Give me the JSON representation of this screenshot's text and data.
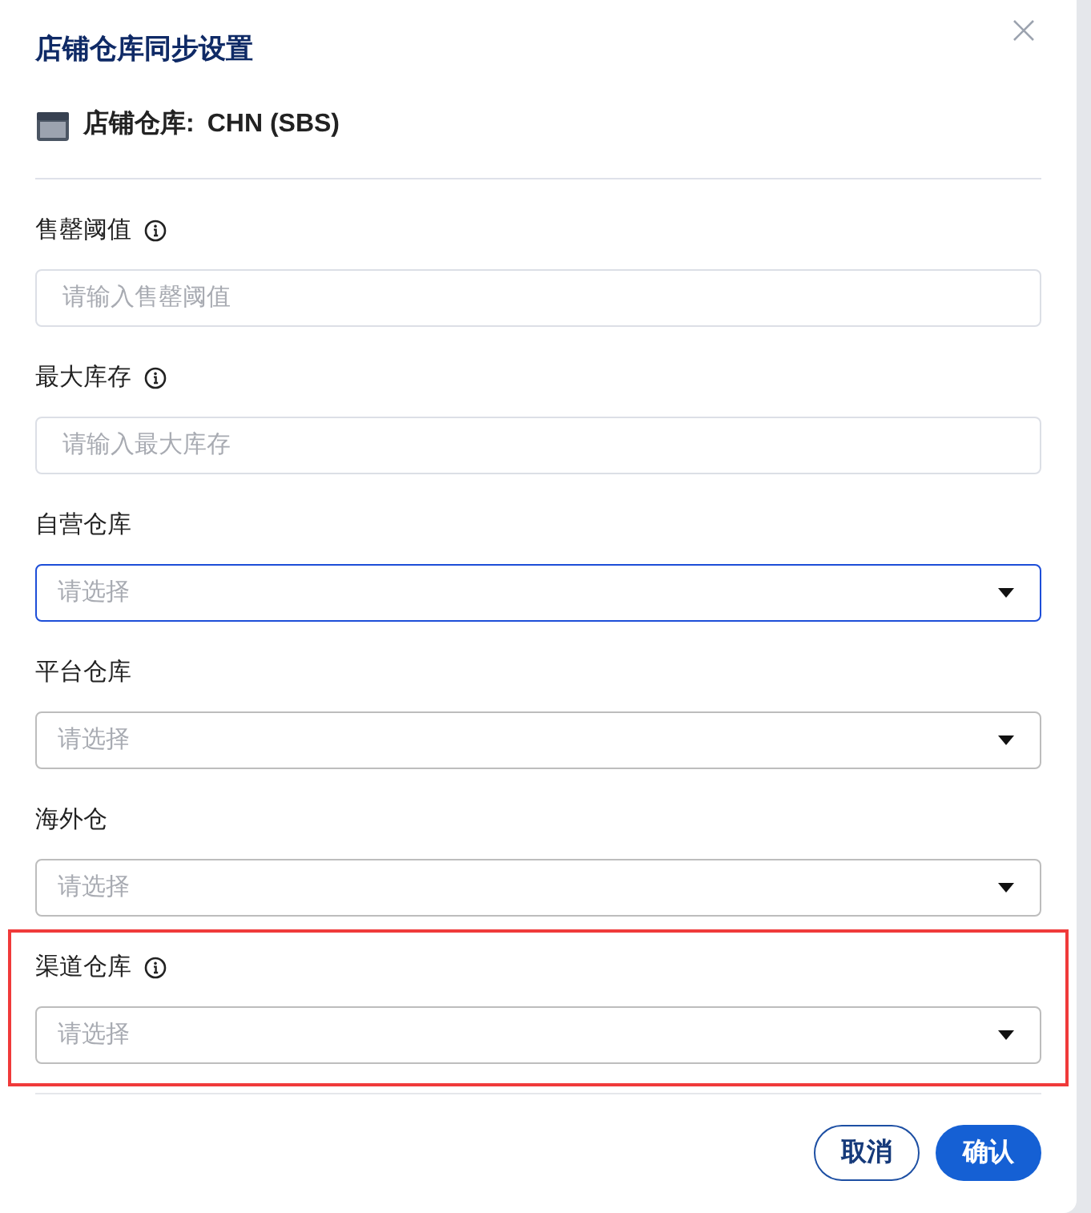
{
  "dialog": {
    "title": "店铺仓库同步设置",
    "store_label": "店铺仓库:",
    "store_value": "CHN (SBS)"
  },
  "fields": [
    {
      "label": "售罄阈值",
      "info": true,
      "kind": "input",
      "placeholder": "请输入售罄阈值",
      "focused": false,
      "highlighted": false
    },
    {
      "label": "最大库存",
      "info": true,
      "kind": "input",
      "placeholder": "请输入最大库存",
      "focused": false,
      "highlighted": false
    },
    {
      "label": "自营仓库",
      "info": false,
      "kind": "select",
      "placeholder": "请选择",
      "focused": true,
      "highlighted": false
    },
    {
      "label": "平台仓库",
      "info": false,
      "kind": "select",
      "placeholder": "请选择",
      "focused": false,
      "highlighted": false
    },
    {
      "label": "海外仓",
      "info": false,
      "kind": "select",
      "placeholder": "请选择",
      "focused": false,
      "highlighted": false
    },
    {
      "label": "渠道仓库",
      "info": true,
      "kind": "select",
      "placeholder": "请选择",
      "focused": false,
      "highlighted": true
    }
  ],
  "buttons": [
    {
      "label": "取消",
      "kind": "secondary"
    },
    {
      "label": "确认",
      "kind": "primary"
    }
  ]
}
